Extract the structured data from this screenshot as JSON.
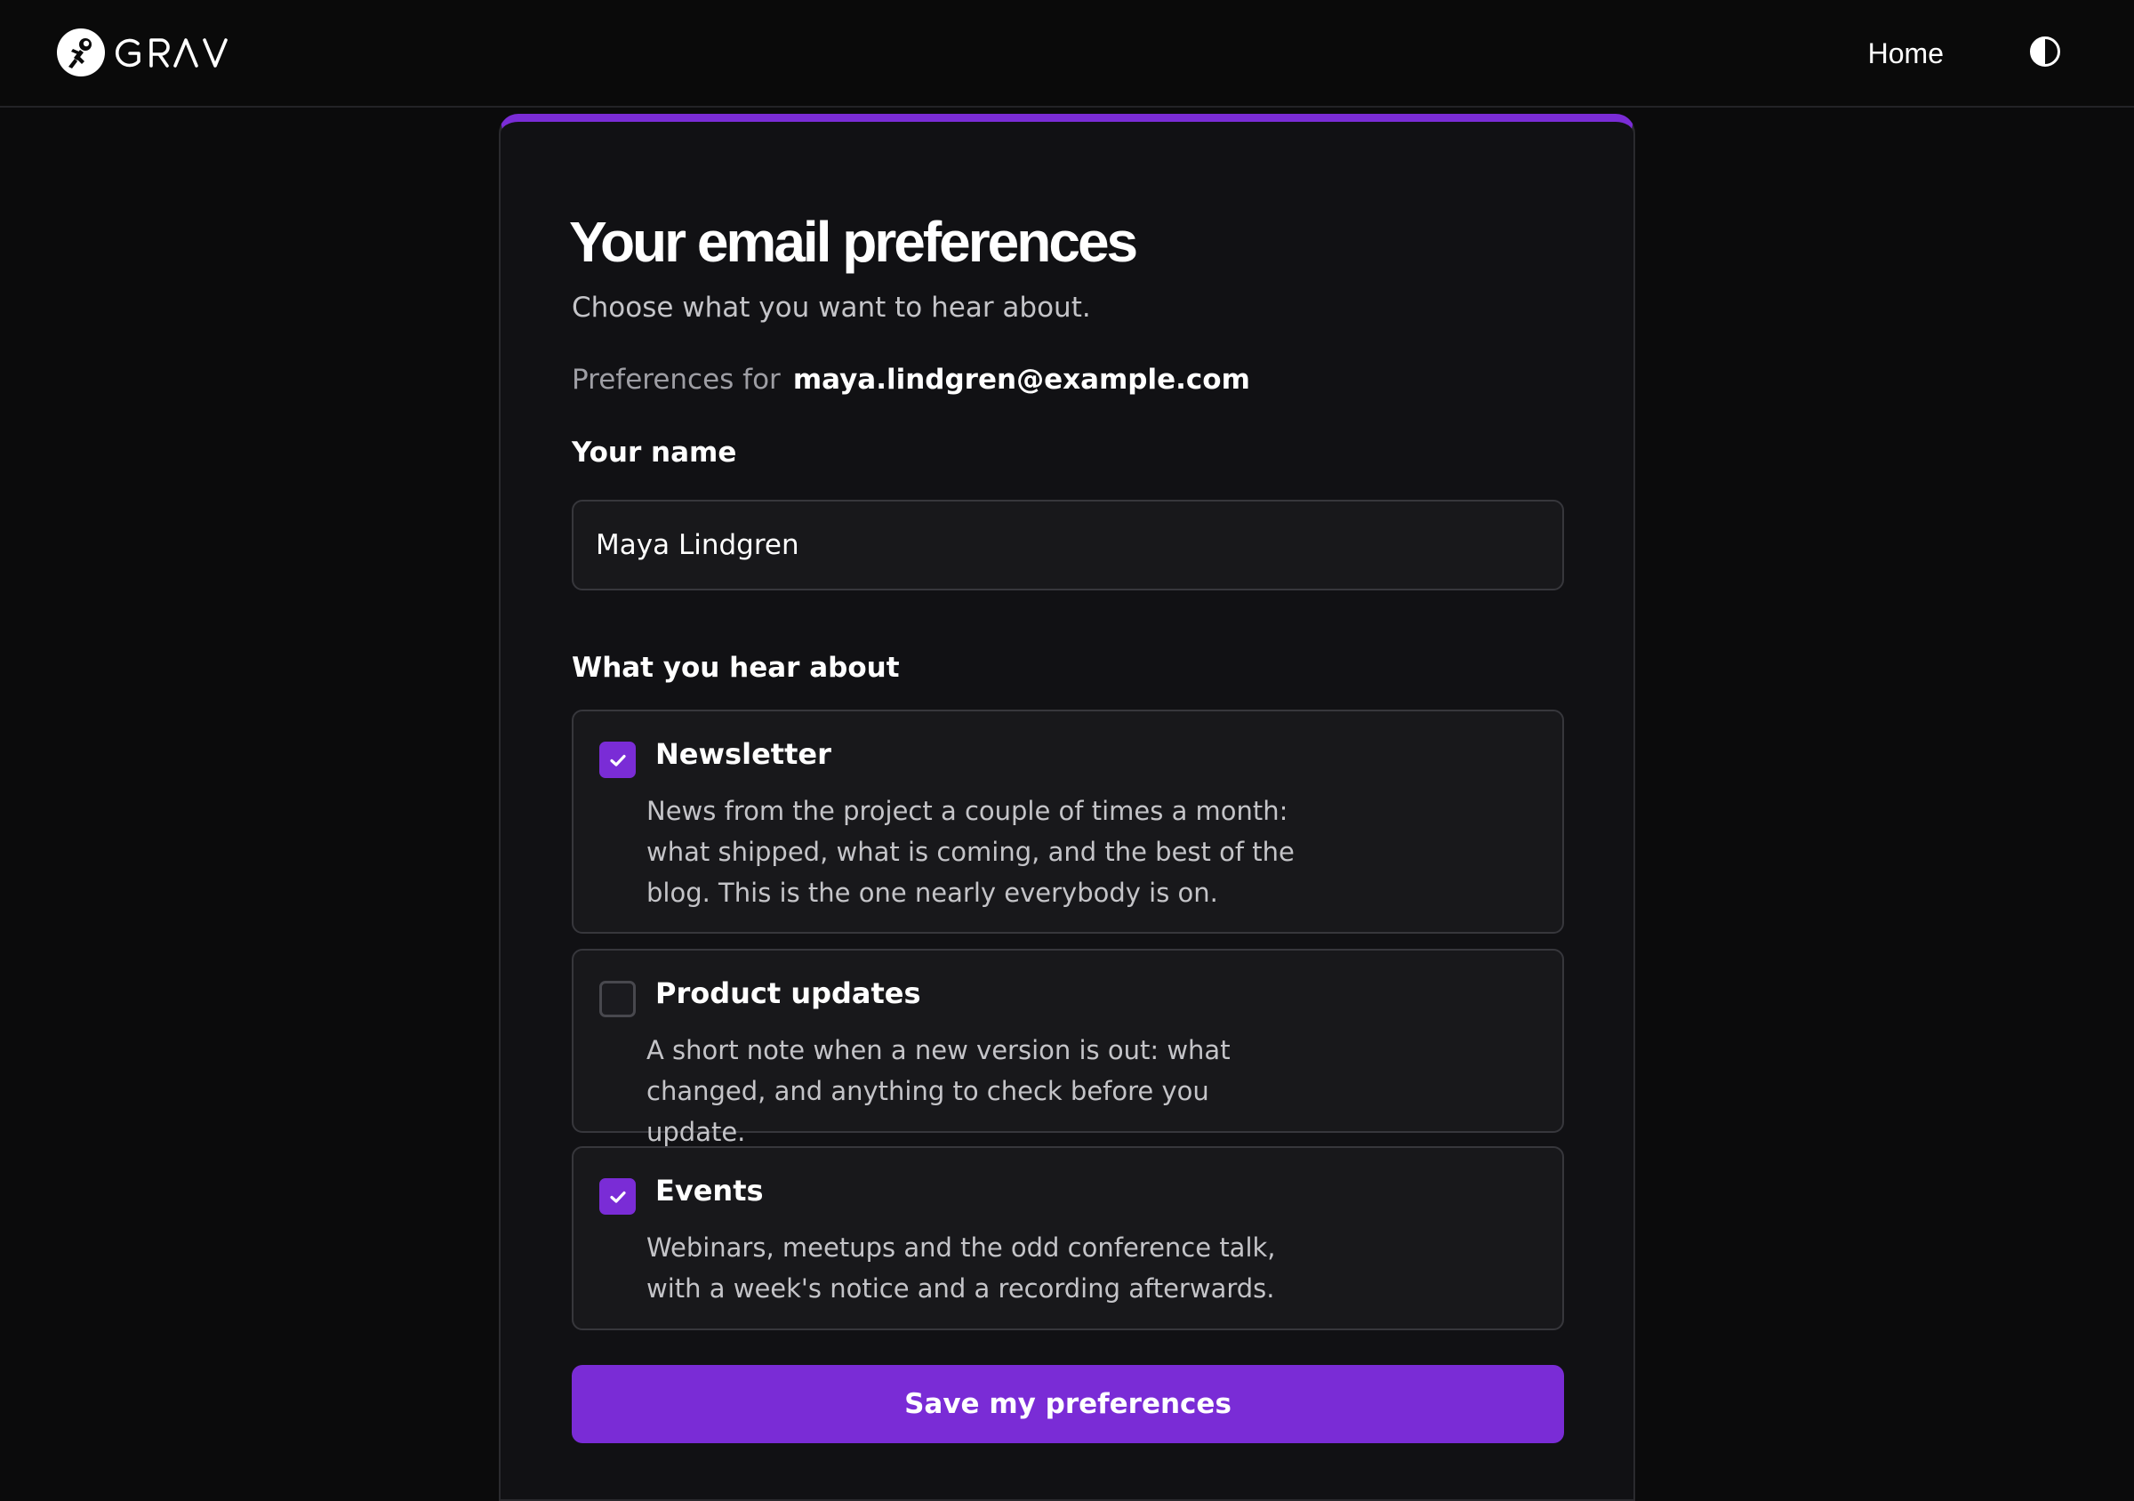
{
  "header": {
    "logo_text": "GRAV",
    "nav_home": "Home",
    "theme_toggle_icon": "contrast-icon"
  },
  "colors": {
    "accent": "#7a2cd6",
    "background": "#0b0b0c",
    "card": "#111114",
    "text_muted": "#c4c4c8"
  },
  "form": {
    "title": "Your email preferences",
    "subtitle": "Choose what you want to hear about.",
    "preferences_for_label": "Preferences for",
    "email": "maya.lindgren@example.com",
    "name_label": "Your name",
    "name_value": "Maya Lindgren",
    "topics_label": "What you hear about",
    "options": [
      {
        "title": "Newsletter",
        "description": "News from the project a couple of times a month: what shipped, what is coming, and the best of the blog. This is the one nearly everybody is on.",
        "checked": true
      },
      {
        "title": "Product updates",
        "description": "A short note when a new version is out: what changed, and anything to check before you update.",
        "checked": false
      },
      {
        "title": "Events",
        "description": "Webinars, meetups and the odd conference talk, with a week's notice and a recording afterwards.",
        "checked": true
      }
    ],
    "save_label": "Save my preferences"
  }
}
